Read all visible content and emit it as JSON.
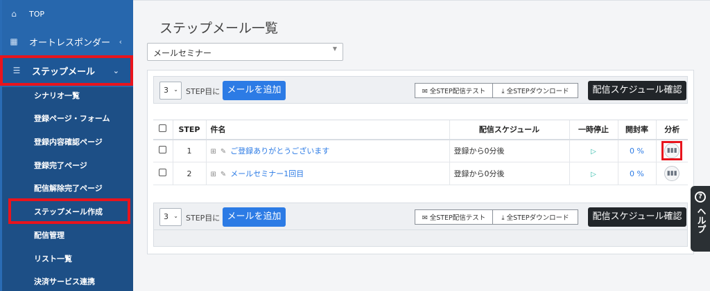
{
  "sidebar": {
    "top": {
      "label": "TOP",
      "icon": "home-icon"
    },
    "autoresponder": {
      "label": "オートレスポンダー",
      "icon": "grid-icon"
    },
    "stepmail": {
      "label": "ステップメール",
      "icon": "list-icon"
    },
    "sub_items": [
      "シナリオ一覧",
      "登録ページ・フォーム",
      "登録内容確認ページ",
      "登録完了ページ",
      "配信解除完了ページ",
      "ステップメール作成",
      "配信管理",
      "リスト一覧",
      "決済サービス連携"
    ]
  },
  "page": {
    "title": "ステップメール一覧",
    "scenario_select": "メールセミナー"
  },
  "toolbar": {
    "step_value": "3",
    "step_label": "STEP目に",
    "add_label": "メールを追加",
    "test_label": "✉ 全STEP配信テスト",
    "download_label": "⤓ 全STEPダウンロード",
    "schedule_label": "配信スケジュール確認"
  },
  "table": {
    "headers": {
      "step": "STEP",
      "subject": "件名",
      "schedule": "配信スケジュール",
      "pause": "一時停止",
      "open_rate": "開封率",
      "analysis": "分析"
    },
    "rows": [
      {
        "step": "1",
        "subject": "ご登録ありがとうございます",
        "schedule": "登録から0分後",
        "open_rate": "0 %"
      },
      {
        "step": "2",
        "subject": "メールセミナー1回目",
        "schedule": "登録から0分後",
        "open_rate": "0 %"
      }
    ]
  },
  "help": {
    "label": "ヘルプ"
  },
  "colors": {
    "sidebar": "#1d4f86",
    "sidebar_top": "#2767ad",
    "accent": "#2c7be5",
    "highlight": "#e8141d",
    "dark_button": "#212529"
  }
}
